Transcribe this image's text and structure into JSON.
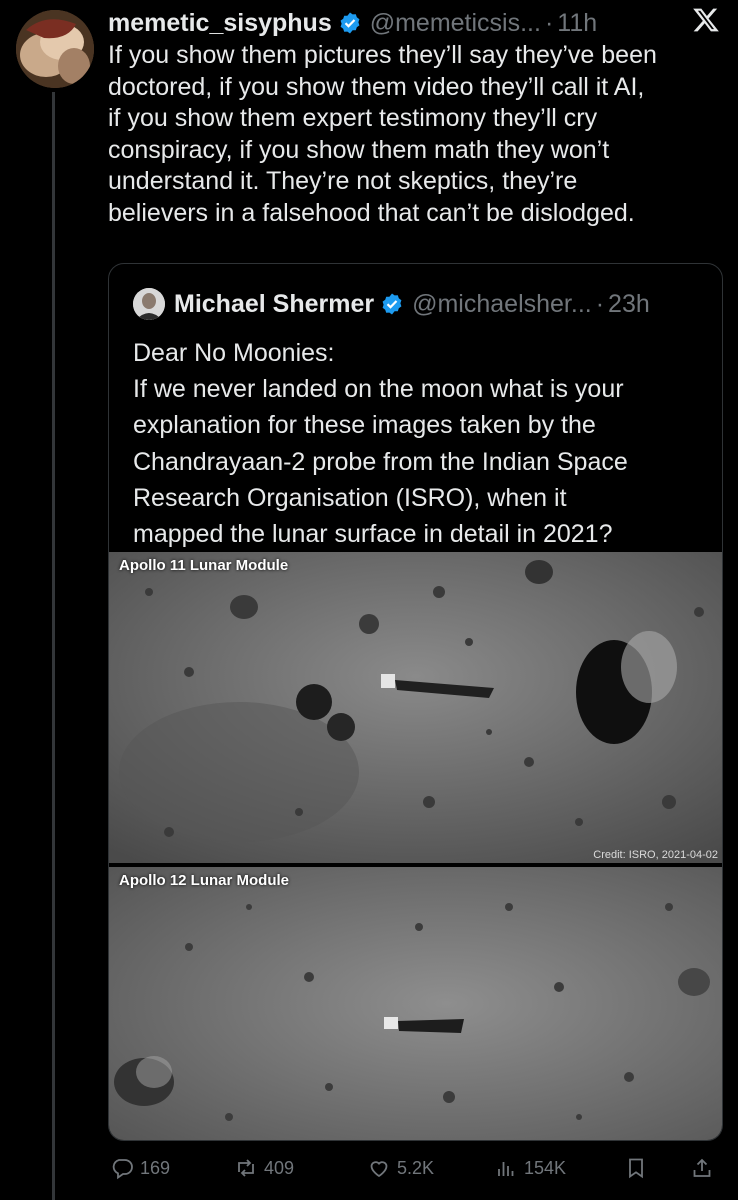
{
  "tweet": {
    "author_name": "memetic_sisyphus",
    "author_handle": "@memeticsis...",
    "separator": "·",
    "time": "11h",
    "text_lines": [
      "If you show them pictures they’ll say they’ve been",
      "doctored, if you show them video they’ll call it AI,",
      "if you show them expert testimony they’ll cry",
      "conspiracy, if you show them math they won’t",
      "understand it. They’re not skeptics, they’re",
      "believers in a falsehood that can’t be dislodged."
    ]
  },
  "quote": {
    "author_name": "Michael Shermer",
    "author_handle": "@michaelsher...",
    "separator": "·",
    "time": "23h",
    "text_lines": [
      "Dear No Moonies:",
      "If we never landed on the moon what is your",
      "explanation for these images taken by the",
      "Chandrayaan-2 probe from the Indian Space",
      "Research Organisation (ISRO), when it",
      "mapped the lunar surface in detail in 2021?"
    ],
    "image_top": {
      "label": "Apollo 11 Lunar Module",
      "credit": "Credit: ISRO, 2021-04-02"
    },
    "image_bottom": {
      "label": "Apollo 12 Lunar Module"
    }
  },
  "actions": {
    "replies": "169",
    "reposts": "409",
    "likes": "5.2K",
    "views": "154K"
  },
  "icons": [
    "verified-badge-icon",
    "x-logo-icon",
    "reply-icon",
    "repost-icon",
    "like-icon",
    "views-icon",
    "bookmark-icon",
    "share-icon"
  ],
  "colors": {
    "background": "#000000",
    "text": "#e7e9ea",
    "muted": "#71767b",
    "verified": "#1d9bf0",
    "border": "#2f3336"
  }
}
